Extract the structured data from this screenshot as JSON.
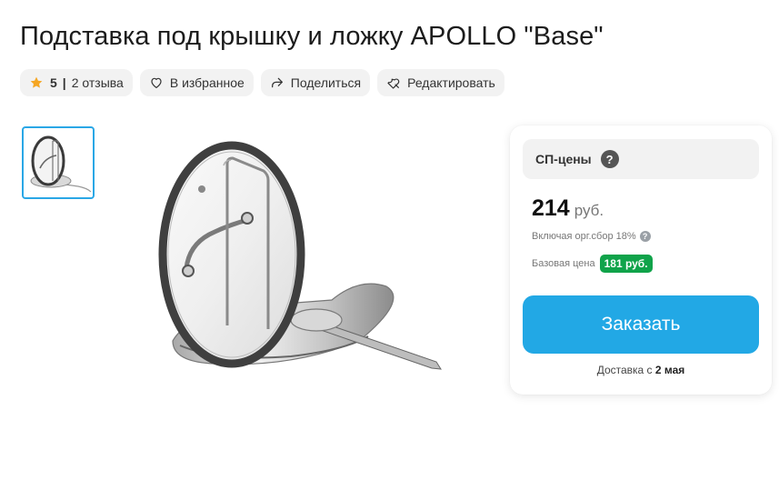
{
  "product": {
    "title": "Подставка под крышку и ложку APOLLO \"Base\""
  },
  "chips": {
    "rating": "5",
    "separator": "|",
    "reviews": "2 отзыва",
    "favorite": "В избранное",
    "share": "Поделиться",
    "edit": "Редактировать"
  },
  "icons": {
    "rating": "star-icon",
    "favorite": "heart-icon",
    "share": "share-arrow-icon",
    "edit": "wrench-icon",
    "help": "question-icon"
  },
  "price_card": {
    "sp_label": "СП-цены",
    "help_symbol": "?",
    "price_value": "214",
    "price_currency": "руб.",
    "fee_text": "Включая орг.сбор 18%",
    "base_label": "Базовая цена",
    "base_price": "181 руб.",
    "order_button": "Заказать",
    "delivery_prefix": "Доставка с",
    "delivery_date": "2 мая"
  },
  "colors": {
    "accent": "#22a8e5",
    "star": "#f5a623",
    "badge_green": "#10a34a",
    "chip_bg": "#f2f2f2"
  }
}
